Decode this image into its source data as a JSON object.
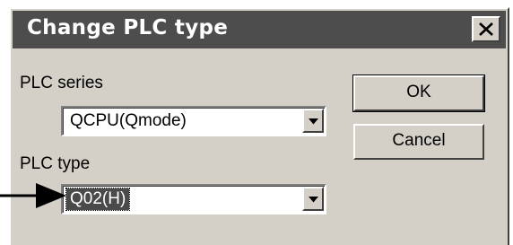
{
  "window": {
    "title": "Change PLC type"
  },
  "plc_series": {
    "label": "PLC series",
    "value": "QCPU(Qmode)"
  },
  "plc_type": {
    "label": "PLC type",
    "value": "Q02(H)"
  },
  "buttons": {
    "ok_label": "OK",
    "cancel_label": "Cancel"
  },
  "icons": {
    "close": "close-icon",
    "dropdown": "chevron-down-icon",
    "pointer": "arrow-right-icon"
  }
}
